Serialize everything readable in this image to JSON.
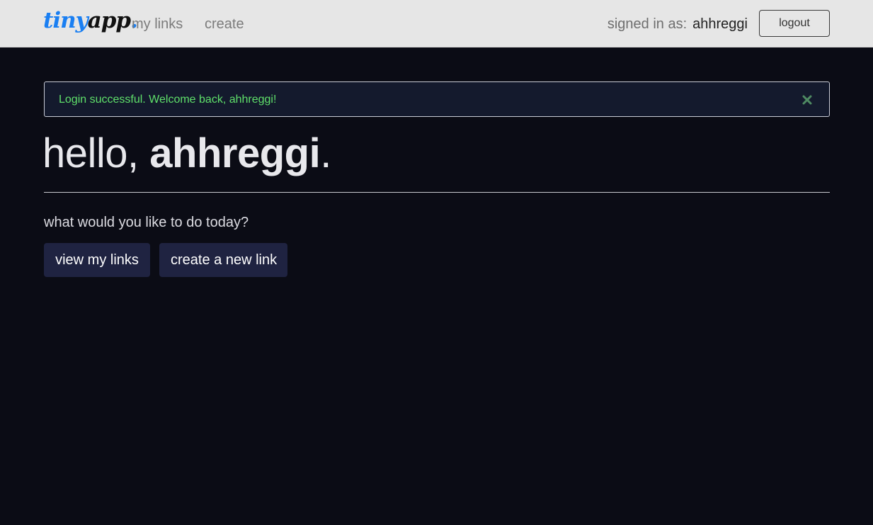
{
  "navbar": {
    "brand": {
      "part1": "tiny",
      "part2": "app",
      "part3": "."
    },
    "links": [
      {
        "label": "my links"
      },
      {
        "label": "create"
      }
    ],
    "signed_in_label": "signed in as:",
    "username": "ahhreggi",
    "logout_label": "logout"
  },
  "alert": {
    "message": "Login successful. Welcome back, ahhreggi!",
    "close_icon": "close-x-icon",
    "text_color": "#5fe06a"
  },
  "main": {
    "greeting": "hello, ",
    "username": "ahhreggi",
    "punctuation": ".",
    "prompt": "what would you like to do today?",
    "buttons": {
      "view_links": "view my links",
      "create_link": "create a new link"
    }
  },
  "colors": {
    "background": "#0b0c15",
    "navbar": "#e6e6e6",
    "brand_blue": "#1a7ff2",
    "button_bg": "#1f2341"
  }
}
